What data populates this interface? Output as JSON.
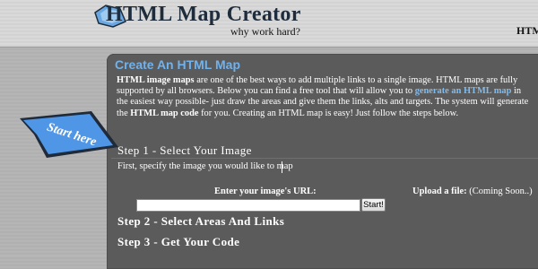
{
  "header": {
    "title": "HTML Map Creator",
    "tagline": "why work hard?",
    "nav_home": "HTM"
  },
  "start_here": "Start here",
  "panel": {
    "title": "Create An HTML Map",
    "intro": {
      "t1": "HTML image maps",
      "t2": " are one of the best ways to add multiple links to a single image. HTML maps are fully supported by all browsers. Below you can find a free tool that will allow you to ",
      "t3": "generate an HTML map",
      "t4": " in the easiest way possible- just draw the areas and give them the links, alts and targets. The system will generate the ",
      "t5": "HTML map code",
      "t6": " for you. Creating an HTML map is easy! Just follow the steps below."
    }
  },
  "steps": {
    "step1": "Step 1 - Select Your Image",
    "step1_text": "First, specify the image you would like to map",
    "url_label": "Enter your image's URL:",
    "url_value": "",
    "start_button": "Start!",
    "upload_label": "Upload a file:",
    "upload_note": " (Coming Soon..)",
    "step2": "Step 2 - Select Areas And Links",
    "step3": "Step 3 - Get Your Code"
  },
  "colors": {
    "panel_bg": "#5b5b5b",
    "title_blue": "#6fb2ee",
    "link_blue": "#7fbcf0",
    "flag_blue": "#4f97e6"
  }
}
